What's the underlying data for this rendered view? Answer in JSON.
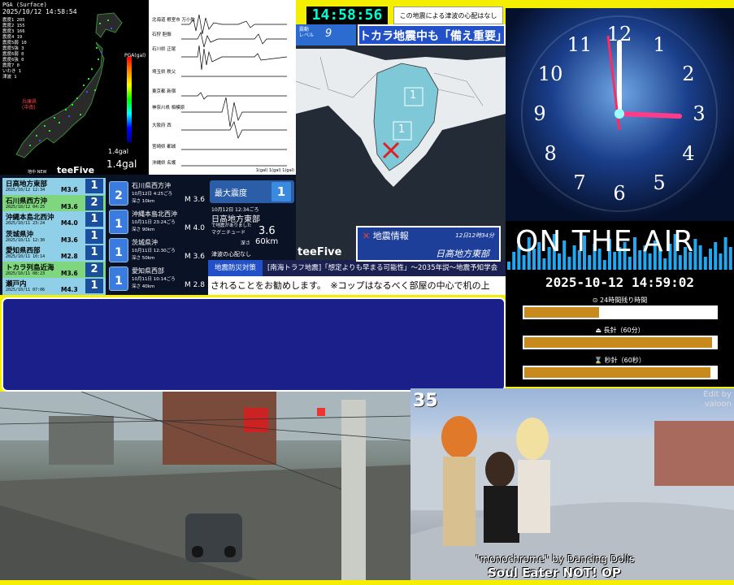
{
  "seismic": {
    "header": "PGA (Surface)",
    "time": "2025/10/12 14:58:54",
    "stats": [
      "震度1 205",
      "震度2 155",
      "震度3 166",
      "震度4 19",
      "震度5弱 10",
      "震度5強 3",
      "震度6弱 0",
      "震度6強 0",
      "震度7 0",
      "いわき 1",
      "津波 1"
    ],
    "scale_label": "PGA(gal)",
    "region": [
      "兵庫県",
      "(中南)"
    ],
    "gal_small": "1.4gal",
    "gal_big": "1.4gal",
    "footer": "地中 NEW",
    "brand": "teeFive"
  },
  "waveform": {
    "rows": [
      "北海道 根室市 万小牧",
      "石狩 胆振",
      "石川県 正尾",
      "埼玉県 秩父",
      "東京都 新宿",
      "神奈川県 相模原",
      "大阪府 西",
      "宮崎県 都城",
      "沖縄県 名護"
    ],
    "units": "1(gal) 1(gal) 1(gal)",
    "brand": "teeFive"
  },
  "top_time": "14:58:56",
  "top_notice": "この地震による津波の心配はなし",
  "eew": {
    "level_label": "震動\nレベル",
    "level": "9",
    "banner": "トカラ地震中も「備え重要」",
    "intensity_markers": [
      "1",
      "1"
    ],
    "brand": "teeFive"
  },
  "quake_list": [
    {
      "name": "日高地方東部",
      "date": "2025/10/12 12:34",
      "mag": "M3.6",
      "int": "1",
      "color": "#8fd0e8"
    },
    {
      "name": "石川県西方沖",
      "date": "2025/10/12 04:25",
      "mag": "M3.6",
      "int": "2",
      "color": "#7ed67e"
    },
    {
      "name": "沖縄本島北西沖",
      "date": "2025/10/11 23:24",
      "mag": "M4.0",
      "int": "1",
      "color": "#8fd0e8"
    },
    {
      "name": "茨城県沖",
      "date": "2025/10/11 12:30",
      "mag": "M3.6",
      "int": "1",
      "color": "#8fd0e8"
    },
    {
      "name": "愛知県西部",
      "date": "2025/10/11 10:14",
      "mag": "M2.8",
      "int": "1",
      "color": "#8fd0e8"
    },
    {
      "name": "トカラ列島近海",
      "date": "2025/10/11 08:23",
      "mag": "M3.6",
      "int": "2",
      "color": "#7ed67e"
    },
    {
      "name": "瀬戸内",
      "date": "2025/10/11 07:06",
      "mag": "M4.3",
      "int": "1",
      "color": "#8fd0e8"
    }
  ],
  "quake_detail": [
    {
      "int": "2",
      "name": "石川県西方沖",
      "date": "10月12日 4:25ごろ",
      "depth": "深さ 10km",
      "mag": "M 3.6"
    },
    {
      "int": "1",
      "name": "沖縄本島北西沖",
      "date": "10月11日 23:24ごろ",
      "depth": "深さ 90km",
      "mag": "M 4.0"
    },
    {
      "int": "1",
      "name": "茨城県沖",
      "date": "10月11日 12:30ごろ",
      "depth": "深さ 50km",
      "mag": "M 3.6"
    },
    {
      "int": "1",
      "name": "愛知県西部",
      "date": "10月11日 10:14ごろ",
      "depth": "深さ 40km",
      "mag": "M 2.8"
    }
  ],
  "max_info": {
    "label": "最大震度",
    "value": "1",
    "datetime": "10月12日 12:34ごろ",
    "place": "日高地方東部",
    "tsunami": "で地震がありました",
    "mag_label": "マグニチュード",
    "mag": "3.6",
    "depth_label": "深さ",
    "depth": "60km",
    "notice": "津波の心配なし"
  },
  "eq_info": {
    "title": "地震情報",
    "time": "12日12時34分",
    "place": "日高地方東部"
  },
  "ticker1": {
    "tag": "地震防災対策",
    "text": "[南海トラフ地震]「想定よりも早まる可能性」〜2035年説〜地震予知学会"
  },
  "ticker2": "されることをお勧めします。　※コップはなるべく部屋の中心で机の上",
  "on_air": "ON THE AIR",
  "datetime": "2025-10-12 14:59:02",
  "bars": [
    {
      "label": "⊙ 24時間残り時間",
      "fraction": 0.39
    },
    {
      "label": "⏏ 長針（60分）",
      "fraction": 0.98
    },
    {
      "label": "⌛ 秒針（60秒）",
      "fraction": 0.97
    }
  ],
  "clock_numerals": [
    "12",
    "1",
    "2",
    "3",
    "4",
    "5",
    "6",
    "7",
    "8",
    "9",
    "10",
    "11"
  ],
  "anime": {
    "number": "35",
    "edit": "Edit by\nvaloon",
    "caption1": "\"monochrome\" by Dancing Dolls",
    "caption2": "Soul Eater NOT! OP"
  }
}
